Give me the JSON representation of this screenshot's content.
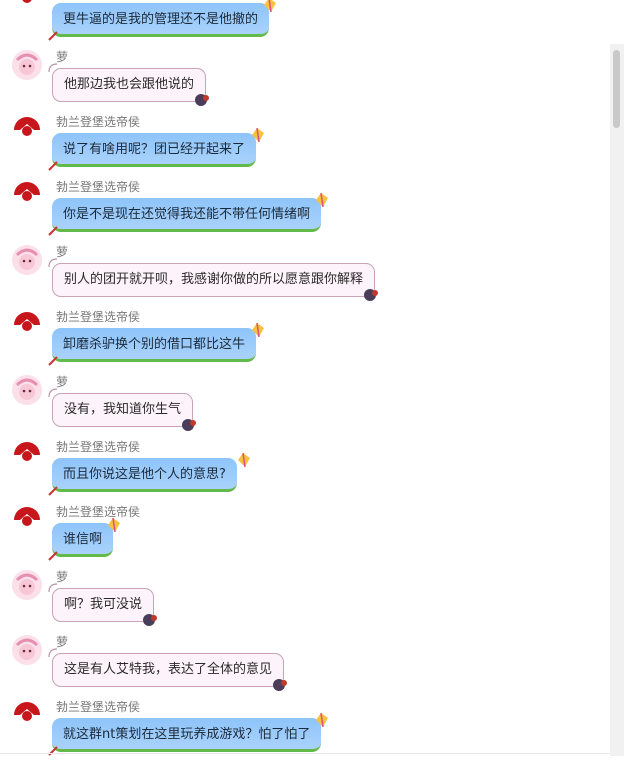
{
  "users": {
    "a": "勃兰登堡选帝侯",
    "b": "萝"
  },
  "messages": [
    {
      "sender": "a",
      "text": "更牛逼的是我的管理还不是他撤的",
      "name_visible": false
    },
    {
      "sender": "b",
      "text": "他那边我也会跟他说的"
    },
    {
      "sender": "a",
      "text": "说了有啥用呢？团已经开起来了"
    },
    {
      "sender": "a",
      "text": "你是不是现在还觉得我还能不带任何情绪啊"
    },
    {
      "sender": "b",
      "text": "别人的团开就开呗，我感谢你做的所以愿意跟你解释"
    },
    {
      "sender": "a",
      "text": "卸磨杀驴换个别的借口都比这牛"
    },
    {
      "sender": "b",
      "text": "没有，我知道你生气"
    },
    {
      "sender": "a",
      "text": "而且你说这是他个人的意思?"
    },
    {
      "sender": "a",
      "text": "谁信啊"
    },
    {
      "sender": "b",
      "text": "啊？我可没说"
    },
    {
      "sender": "b",
      "text": "这是有人艾特我，表达了全体的意见"
    },
    {
      "sender": "a",
      "text": "就这群nt策划在这里玩养成游戏？怕了怕了"
    }
  ],
  "colors": {
    "blue_bubble": "#a9d2fb",
    "blue_bubble_border": "#63b94a",
    "pink_bubble": "#fdf3fa",
    "pink_bubble_border": "#c9a3b6"
  }
}
